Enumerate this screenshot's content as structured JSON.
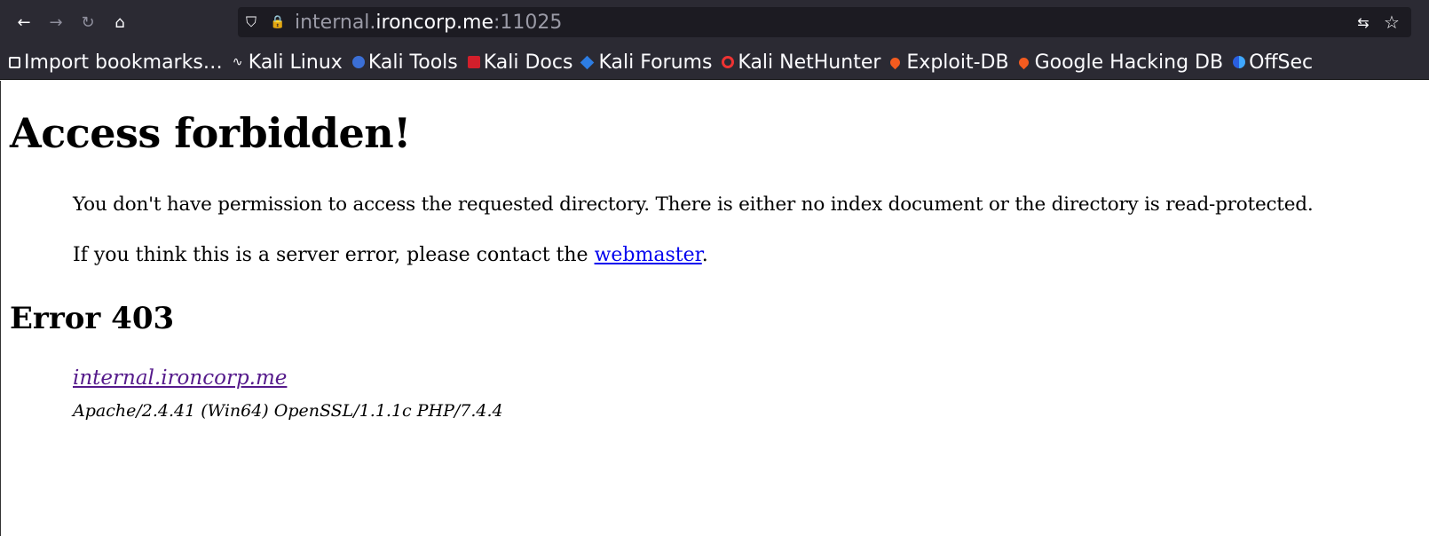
{
  "browser": {
    "url_prefix": "internal.",
    "url_host": "ironcorp.me",
    "url_port": ":11025",
    "icons": {
      "back": "arrow-left-icon",
      "forward": "arrow-right-icon",
      "reload": "reload-icon",
      "home": "home-icon",
      "shield": "shield-icon",
      "lock": "lock-icon",
      "translate": "translate-icon",
      "bookmark": "star-icon"
    },
    "glyphs": {
      "back": "←",
      "forward": "→",
      "reload": "↻",
      "home": "⌂",
      "shield": "⛉",
      "lock": "🔒",
      "translate": "⇆",
      "bookmark": "☆"
    }
  },
  "bookmarks": [
    {
      "label": "Import bookmarks…"
    },
    {
      "label": "Kali Linux"
    },
    {
      "label": "Kali Tools"
    },
    {
      "label": "Kali Docs"
    },
    {
      "label": "Kali Forums"
    },
    {
      "label": "Kali NetHunter"
    },
    {
      "label": "Exploit-DB"
    },
    {
      "label": "Google Hacking DB"
    },
    {
      "label": "OffSec"
    }
  ],
  "page": {
    "title": "Access forbidden!",
    "message": "You don't have permission to access the requested directory. There is either no index document or the directory is read-protected.",
    "contact_before": "If you think this is a server error, please contact the ",
    "contact_link": "webmaster",
    "contact_after": ".",
    "error_heading": "Error 403",
    "address_host": "internal.ironcorp.me",
    "server_signature": "Apache/2.4.41 (Win64) OpenSSL/1.1.1c PHP/7.4.4"
  },
  "colors": {
    "chrome_bg": "#2b2a33",
    "urlbar_bg": "#1c1b22",
    "link": "#0000ee",
    "visited_link": "#551a8b"
  }
}
